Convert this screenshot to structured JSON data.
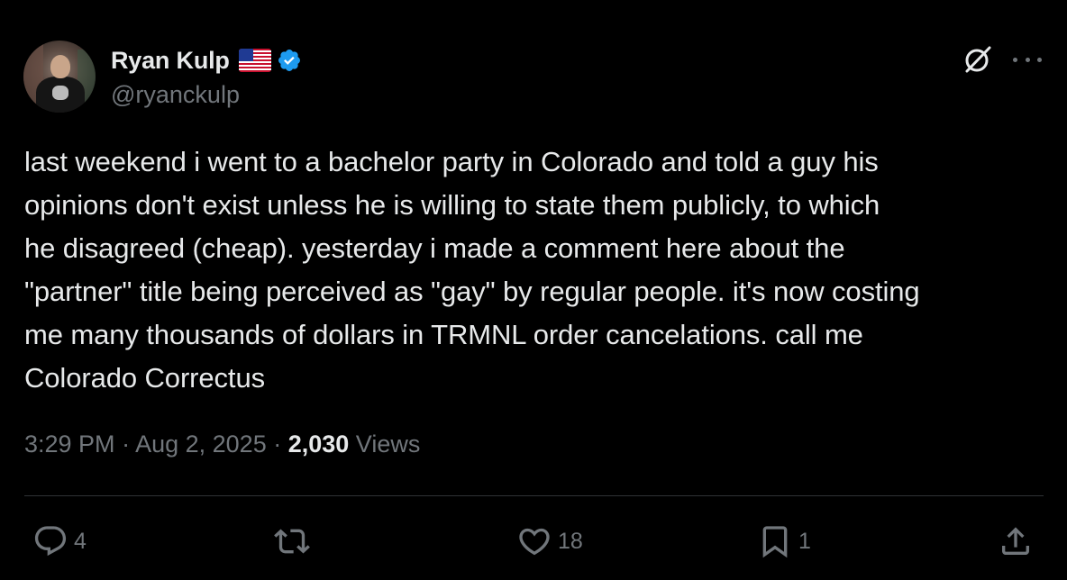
{
  "author": {
    "display_name": "Ryan Kulp",
    "handle": "@ryanckulp",
    "flag_emoji_name": "us-flag",
    "verified": true,
    "verified_color": "#1d9bf0"
  },
  "header_icons": [
    "grok-icon",
    "more-icon"
  ],
  "tweet": {
    "lines": [
      "last weekend i went to a bachelor party in Colorado and told a guy his",
      "opinions don't exist unless he is willing to state them publicly, to which",
      "he disagreed (cheap). yesterday i made a comment here about the",
      "\"partner\" title being perceived as \"gay\" by regular people. it's now costing",
      "me many thousands of dollars in TRMNL order cancelations. call me",
      "Colorado Correctus"
    ]
  },
  "meta": {
    "time": "3:29 PM",
    "sep1": " · ",
    "date": "Aug 2, 2025",
    "sep2": " · ",
    "views_count": "2,030",
    "views_label": " Views"
  },
  "actions": {
    "reply_count": "4",
    "repost_count": "",
    "like_count": "18",
    "bookmark_count": "1"
  },
  "colors": {
    "background": "#000000",
    "text": "#e7e9ea",
    "secondary": "#71767b",
    "divider": "#2f3336",
    "accent": "#1d9bf0"
  }
}
